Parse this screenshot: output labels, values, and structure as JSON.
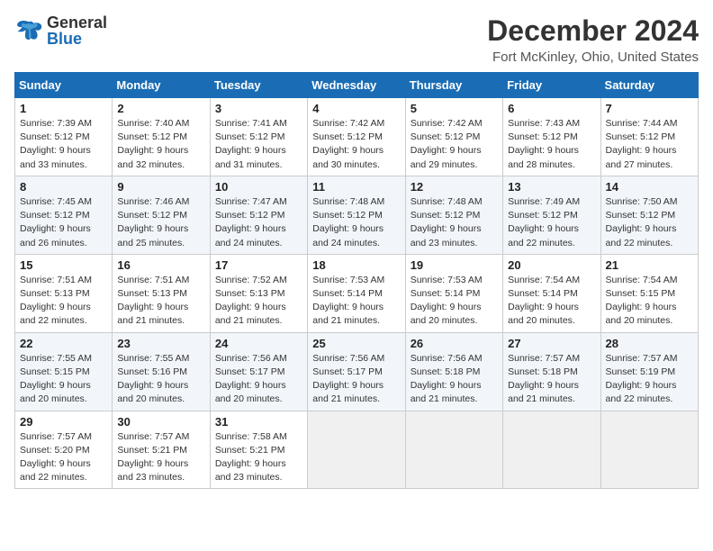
{
  "header": {
    "logo_general": "General",
    "logo_blue": "Blue",
    "month_title": "December 2024",
    "location": "Fort McKinley, Ohio, United States"
  },
  "weekdays": [
    "Sunday",
    "Monday",
    "Tuesday",
    "Wednesday",
    "Thursday",
    "Friday",
    "Saturday"
  ],
  "weeks": [
    [
      {
        "day": "1",
        "sunrise": "Sunrise: 7:39 AM",
        "sunset": "Sunset: 5:12 PM",
        "daylight": "Daylight: 9 hours and 33 minutes."
      },
      {
        "day": "2",
        "sunrise": "Sunrise: 7:40 AM",
        "sunset": "Sunset: 5:12 PM",
        "daylight": "Daylight: 9 hours and 32 minutes."
      },
      {
        "day": "3",
        "sunrise": "Sunrise: 7:41 AM",
        "sunset": "Sunset: 5:12 PM",
        "daylight": "Daylight: 9 hours and 31 minutes."
      },
      {
        "day": "4",
        "sunrise": "Sunrise: 7:42 AM",
        "sunset": "Sunset: 5:12 PM",
        "daylight": "Daylight: 9 hours and 30 minutes."
      },
      {
        "day": "5",
        "sunrise": "Sunrise: 7:42 AM",
        "sunset": "Sunset: 5:12 PM",
        "daylight": "Daylight: 9 hours and 29 minutes."
      },
      {
        "day": "6",
        "sunrise": "Sunrise: 7:43 AM",
        "sunset": "Sunset: 5:12 PM",
        "daylight": "Daylight: 9 hours and 28 minutes."
      },
      {
        "day": "7",
        "sunrise": "Sunrise: 7:44 AM",
        "sunset": "Sunset: 5:12 PM",
        "daylight": "Daylight: 9 hours and 27 minutes."
      }
    ],
    [
      {
        "day": "8",
        "sunrise": "Sunrise: 7:45 AM",
        "sunset": "Sunset: 5:12 PM",
        "daylight": "Daylight: 9 hours and 26 minutes."
      },
      {
        "day": "9",
        "sunrise": "Sunrise: 7:46 AM",
        "sunset": "Sunset: 5:12 PM",
        "daylight": "Daylight: 9 hours and 25 minutes."
      },
      {
        "day": "10",
        "sunrise": "Sunrise: 7:47 AM",
        "sunset": "Sunset: 5:12 PM",
        "daylight": "Daylight: 9 hours and 24 minutes."
      },
      {
        "day": "11",
        "sunrise": "Sunrise: 7:48 AM",
        "sunset": "Sunset: 5:12 PM",
        "daylight": "Daylight: 9 hours and 24 minutes."
      },
      {
        "day": "12",
        "sunrise": "Sunrise: 7:48 AM",
        "sunset": "Sunset: 5:12 PM",
        "daylight": "Daylight: 9 hours and 23 minutes."
      },
      {
        "day": "13",
        "sunrise": "Sunrise: 7:49 AM",
        "sunset": "Sunset: 5:12 PM",
        "daylight": "Daylight: 9 hours and 22 minutes."
      },
      {
        "day": "14",
        "sunrise": "Sunrise: 7:50 AM",
        "sunset": "Sunset: 5:12 PM",
        "daylight": "Daylight: 9 hours and 22 minutes."
      }
    ],
    [
      {
        "day": "15",
        "sunrise": "Sunrise: 7:51 AM",
        "sunset": "Sunset: 5:13 PM",
        "daylight": "Daylight: 9 hours and 22 minutes."
      },
      {
        "day": "16",
        "sunrise": "Sunrise: 7:51 AM",
        "sunset": "Sunset: 5:13 PM",
        "daylight": "Daylight: 9 hours and 21 minutes."
      },
      {
        "day": "17",
        "sunrise": "Sunrise: 7:52 AM",
        "sunset": "Sunset: 5:13 PM",
        "daylight": "Daylight: 9 hours and 21 minutes."
      },
      {
        "day": "18",
        "sunrise": "Sunrise: 7:53 AM",
        "sunset": "Sunset: 5:14 PM",
        "daylight": "Daylight: 9 hours and 21 minutes."
      },
      {
        "day": "19",
        "sunrise": "Sunrise: 7:53 AM",
        "sunset": "Sunset: 5:14 PM",
        "daylight": "Daylight: 9 hours and 20 minutes."
      },
      {
        "day": "20",
        "sunrise": "Sunrise: 7:54 AM",
        "sunset": "Sunset: 5:14 PM",
        "daylight": "Daylight: 9 hours and 20 minutes."
      },
      {
        "day": "21",
        "sunrise": "Sunrise: 7:54 AM",
        "sunset": "Sunset: 5:15 PM",
        "daylight": "Daylight: 9 hours and 20 minutes."
      }
    ],
    [
      {
        "day": "22",
        "sunrise": "Sunrise: 7:55 AM",
        "sunset": "Sunset: 5:15 PM",
        "daylight": "Daylight: 9 hours and 20 minutes."
      },
      {
        "day": "23",
        "sunrise": "Sunrise: 7:55 AM",
        "sunset": "Sunset: 5:16 PM",
        "daylight": "Daylight: 9 hours and 20 minutes."
      },
      {
        "day": "24",
        "sunrise": "Sunrise: 7:56 AM",
        "sunset": "Sunset: 5:17 PM",
        "daylight": "Daylight: 9 hours and 20 minutes."
      },
      {
        "day": "25",
        "sunrise": "Sunrise: 7:56 AM",
        "sunset": "Sunset: 5:17 PM",
        "daylight": "Daylight: 9 hours and 21 minutes."
      },
      {
        "day": "26",
        "sunrise": "Sunrise: 7:56 AM",
        "sunset": "Sunset: 5:18 PM",
        "daylight": "Daylight: 9 hours and 21 minutes."
      },
      {
        "day": "27",
        "sunrise": "Sunrise: 7:57 AM",
        "sunset": "Sunset: 5:18 PM",
        "daylight": "Daylight: 9 hours and 21 minutes."
      },
      {
        "day": "28",
        "sunrise": "Sunrise: 7:57 AM",
        "sunset": "Sunset: 5:19 PM",
        "daylight": "Daylight: 9 hours and 22 minutes."
      }
    ],
    [
      {
        "day": "29",
        "sunrise": "Sunrise: 7:57 AM",
        "sunset": "Sunset: 5:20 PM",
        "daylight": "Daylight: 9 hours and 22 minutes."
      },
      {
        "day": "30",
        "sunrise": "Sunrise: 7:57 AM",
        "sunset": "Sunset: 5:21 PM",
        "daylight": "Daylight: 9 hours and 23 minutes."
      },
      {
        "day": "31",
        "sunrise": "Sunrise: 7:58 AM",
        "sunset": "Sunset: 5:21 PM",
        "daylight": "Daylight: 9 hours and 23 minutes."
      },
      null,
      null,
      null,
      null
    ]
  ]
}
